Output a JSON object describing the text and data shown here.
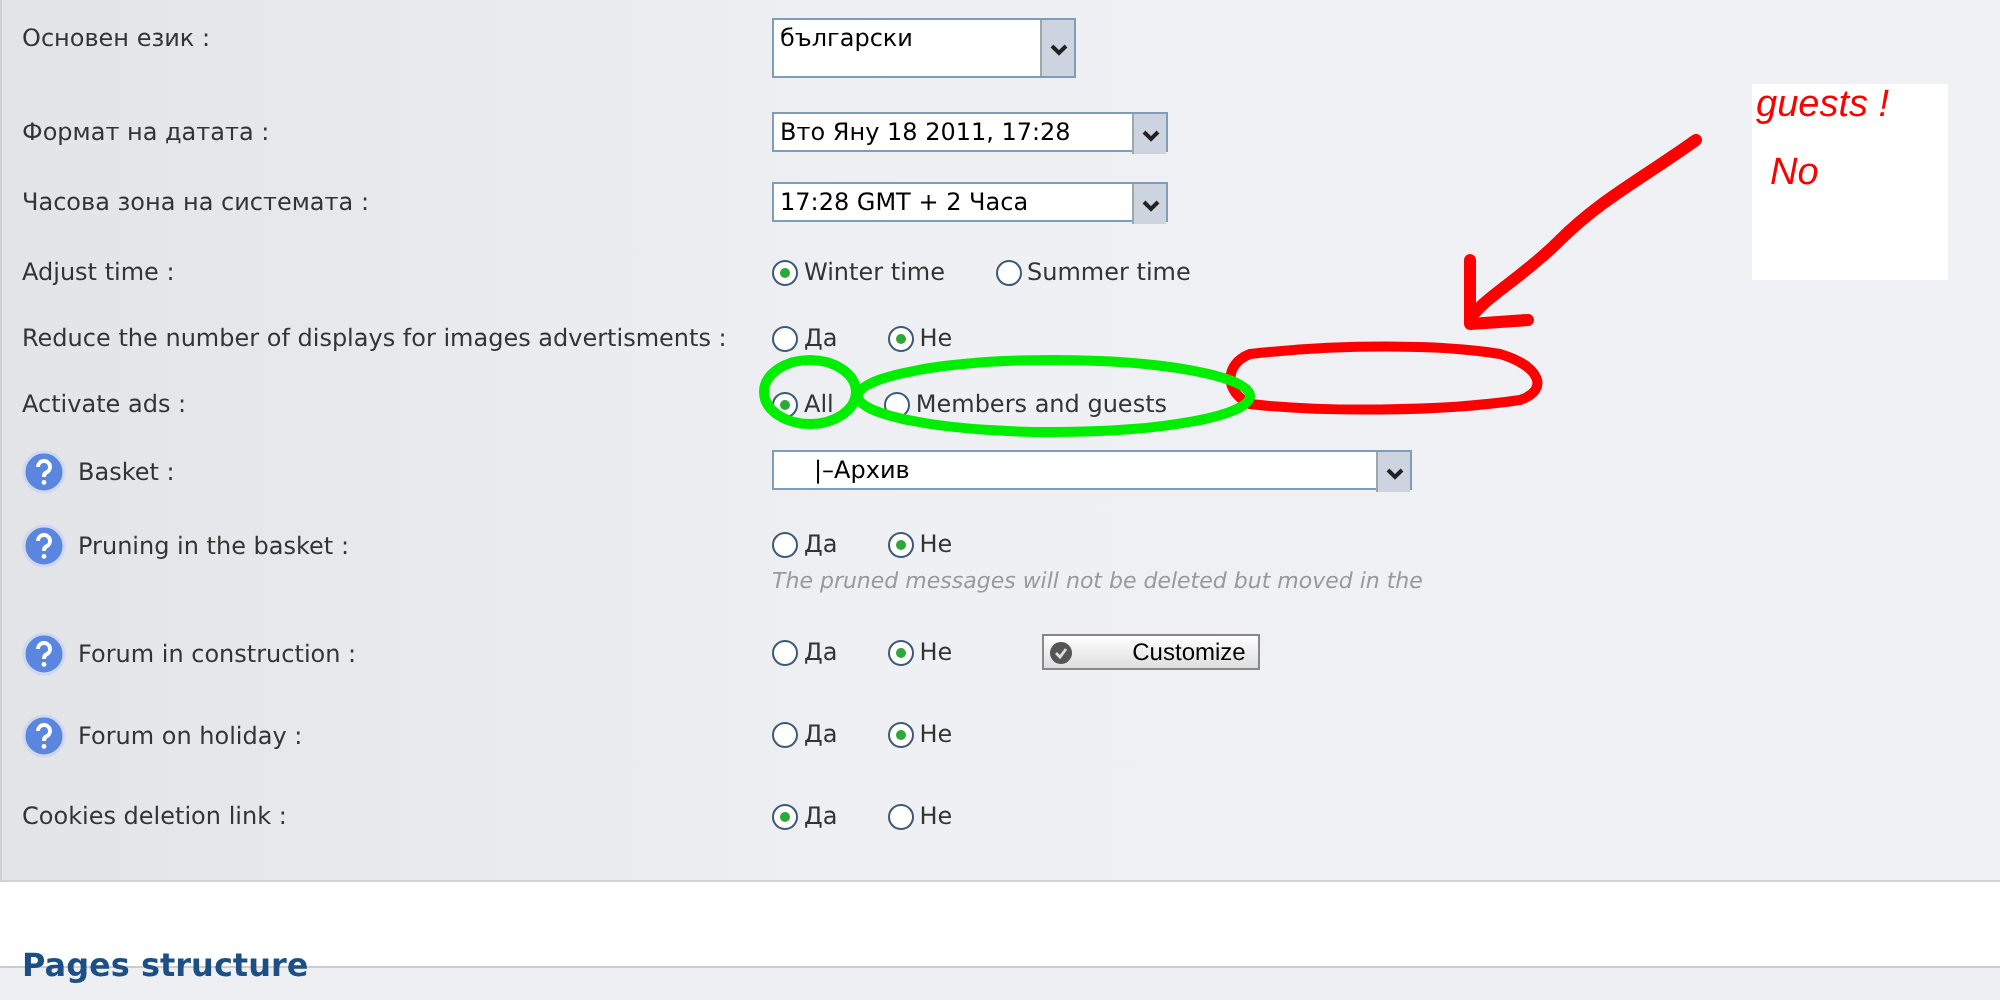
{
  "settings": [
    {
      "label": "Основен език :",
      "help": false,
      "kind": "select",
      "value": "български",
      "tall": true
    },
    {
      "label": "Формат на датата :",
      "help": false,
      "kind": "select",
      "value": "Вто Яну 18 2011, 17:28"
    },
    {
      "label": "Часова зона на системата :",
      "help": false,
      "kind": "select",
      "value": "17:28 GMT + 2 Часа"
    },
    {
      "label": "Adjust time :",
      "help": false,
      "kind": "radio",
      "options": [
        {
          "label": "Winter time",
          "selected": true
        },
        {
          "label": "Summer time",
          "selected": false
        }
      ]
    },
    {
      "label": "Reduce the number of displays for images advertisments :",
      "help": false,
      "kind": "radio",
      "options": [
        {
          "label": "Да",
          "selected": false
        },
        {
          "label": "Не",
          "selected": true
        }
      ]
    },
    {
      "label": "Activate ads :",
      "help": false,
      "kind": "radio",
      "options": [
        {
          "label": "All",
          "selected": true
        },
        {
          "label": "Members and guests",
          "selected": false
        }
      ]
    },
    {
      "label": "Basket :",
      "help": true,
      "kind": "select",
      "value": "|–Архив",
      "wide": true
    },
    {
      "label": "Pruning in the basket :",
      "help": true,
      "kind": "radio",
      "options": [
        {
          "label": "Да",
          "selected": false
        },
        {
          "label": "Не",
          "selected": true
        }
      ],
      "hint": "The pruned messages will not be deleted but moved in the"
    },
    {
      "label": "Forum in construction :",
      "help": true,
      "kind": "radio",
      "options": [
        {
          "label": "Да",
          "selected": false
        },
        {
          "label": "Не",
          "selected": true
        }
      ],
      "button": "Customize"
    },
    {
      "label": "Forum on holiday :",
      "help": true,
      "kind": "radio",
      "options": [
        {
          "label": "Да",
          "selected": false
        },
        {
          "label": "Не",
          "selected": true
        }
      ]
    },
    {
      "label": "Cookies deletion link :",
      "help": false,
      "kind": "radio",
      "options": [
        {
          "label": "Да",
          "selected": true
        },
        {
          "label": "Не",
          "selected": false
        }
      ]
    }
  ],
  "section_heading": "Pages structure",
  "annotation_note": [
    "guests !",
    "No"
  ]
}
